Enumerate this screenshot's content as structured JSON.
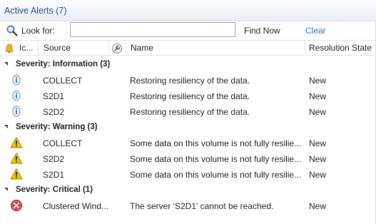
{
  "window": {
    "title": "Active Alerts (7)"
  },
  "search": {
    "look_for_label": "Look for:",
    "value": "",
    "find_now_label": "Find Now",
    "clear_label": "Clear"
  },
  "columns": {
    "icon": "Ic...",
    "source": "Source",
    "name": "Name",
    "resolution_state": "Resolution State"
  },
  "groups": [
    {
      "label": "Severity: Information (3)",
      "severity": "information",
      "rows": [
        {
          "icon": "information-icon",
          "source": "COLLECT",
          "name": "Restoring resiliency of the data.",
          "state": "New"
        },
        {
          "icon": "information-icon",
          "source": "S2D1",
          "name": "Restoring resiliency of the data.",
          "state": "New"
        },
        {
          "icon": "information-icon",
          "source": "S2D2",
          "name": "Restoring resiliency of the data.",
          "state": "New"
        }
      ]
    },
    {
      "label": "Severity: Warning (3)",
      "severity": "warning",
      "rows": [
        {
          "icon": "warning-icon",
          "source": "COLLECT",
          "name": "Some data on this volume is not fully resilie...",
          "state": "New"
        },
        {
          "icon": "warning-icon",
          "source": "S2D2",
          "name": "Some data on this volume is not fully resilie...",
          "state": "New"
        },
        {
          "icon": "warning-icon",
          "source": "S2D1",
          "name": "Some data on this volume is not fully resilie...",
          "state": "New"
        }
      ]
    },
    {
      "label": "Severity: Critical (1)",
      "severity": "critical",
      "rows": [
        {
          "icon": "critical-icon",
          "source": "Clustered Wind...",
          "name": "The server 'S2D1' cannot be reached.",
          "state": "New"
        }
      ]
    }
  ],
  "colors": {
    "title": "#1e4f91",
    "link": "#2f6fb6",
    "warning": "#f5c400",
    "critical": "#d9333f",
    "information": "#3a78c8"
  }
}
